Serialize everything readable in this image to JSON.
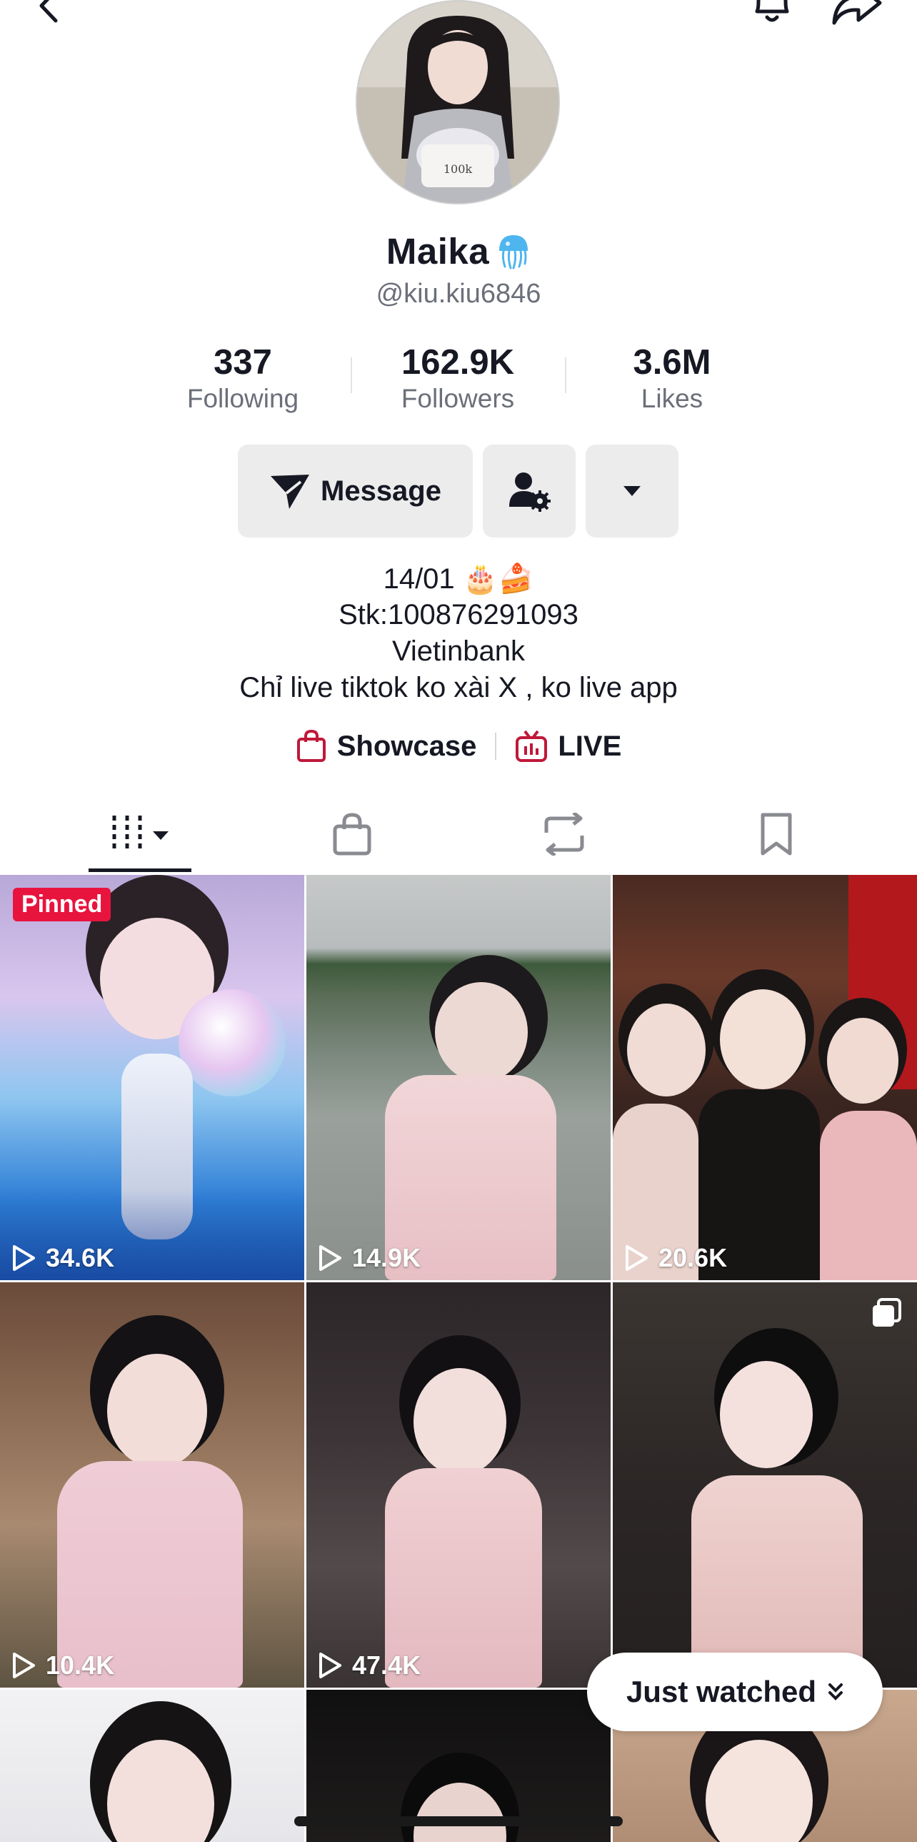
{
  "profile": {
    "display_name": "Maika",
    "handle": "@kiu.kiu6846"
  },
  "stats": [
    {
      "value": "337",
      "label": "Following"
    },
    {
      "value": "162.9K",
      "label": "Followers"
    },
    {
      "value": "3.6M",
      "label": "Likes"
    }
  ],
  "actions": {
    "message_label": "Message"
  },
  "bio": [
    "14/01 🎂🍰",
    "Stk:100876291093",
    "Vietinbank",
    "Chỉ live tiktok ko xài X , ko live app"
  ],
  "links": {
    "showcase": "Showcase",
    "live": "LIVE"
  },
  "tabs": [
    "videos-icon",
    "shop-icon",
    "reposts-icon",
    "saved-icon"
  ],
  "videos": [
    {
      "views": "34.6K",
      "badge": "Pinned"
    },
    {
      "views": "14.9K"
    },
    {
      "views": "20.6K"
    },
    {
      "views": "10.4K"
    },
    {
      "views": "47.4K"
    },
    {
      "views": ""
    }
  ],
  "floating": {
    "just_watched": "Just watched"
  },
  "colors": {
    "accent": "#e8143e",
    "icon_red": "#c0183a",
    "secondary_text": "#6b6f79",
    "button_bg": "#ececec"
  }
}
